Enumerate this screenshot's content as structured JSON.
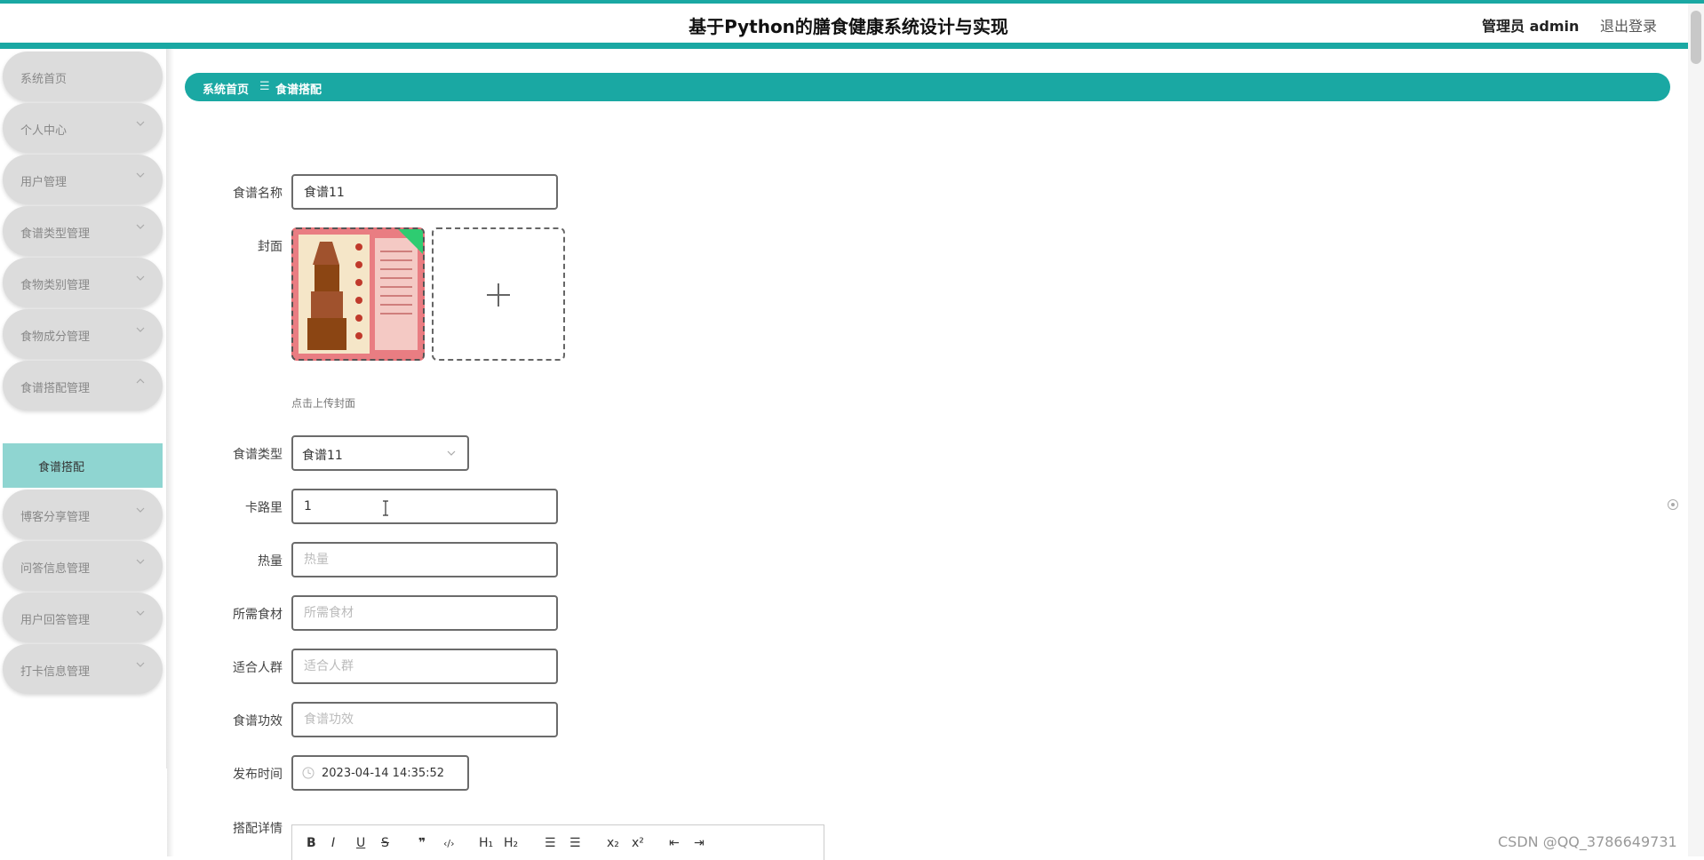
{
  "header": {
    "title": "基于Python的膳食健康系统设计与实现",
    "user": "管理员 admin",
    "logout": "退出登录"
  },
  "sidebar": {
    "items": [
      {
        "label": "系统首页"
      },
      {
        "label": "个人中心"
      },
      {
        "label": "用户管理"
      },
      {
        "label": "食谱类型管理"
      },
      {
        "label": "食物类别管理"
      },
      {
        "label": "食物成分管理"
      },
      {
        "label": "食谱搭配管理"
      },
      {
        "label": "博客分享管理"
      },
      {
        "label": "问答信息管理"
      },
      {
        "label": "用户回答管理"
      },
      {
        "label": "打卡信息管理"
      }
    ],
    "active_sub": "食谱搭配"
  },
  "breadcrumb": {
    "home": "系统首页",
    "separator": "☰",
    "current": "食谱搭配"
  },
  "form": {
    "name_label": "食谱名称",
    "name_value": "食谱11",
    "cover_label": "封面",
    "cover_hint": "点击上传封面",
    "type_label": "食谱类型",
    "type_value": "食谱11",
    "calories_label": "卡路里",
    "calories_value": "1",
    "heat_label": "热量",
    "heat_placeholder": "热量",
    "ingredients_label": "所需食材",
    "ingredients_placeholder": "所需食材",
    "people_label": "适合人群",
    "people_placeholder": "适合人群",
    "effect_label": "食谱功效",
    "effect_placeholder": "食谱功效",
    "time_label": "发布时间",
    "time_value": "2023-04-14 14:35:52",
    "detail_label": "搭配详情"
  },
  "editor": {
    "bold": "B",
    "italic": "I",
    "underline": "U",
    "strike": "S",
    "quote": "❞",
    "code": "‹/›",
    "h1": "H₁",
    "h2": "H₂",
    "ol": "☰",
    "ul": "☰",
    "sub": "x₂",
    "sup": "x²",
    "outdent": "⇤",
    "indent": "⇥"
  },
  "watermark": "CSDN @QQ_3786649731",
  "colors": {
    "accent": "#1aa8a3",
    "active_sub_bg": "#8fd5d1",
    "menu_bg": "#dcdcdc"
  }
}
